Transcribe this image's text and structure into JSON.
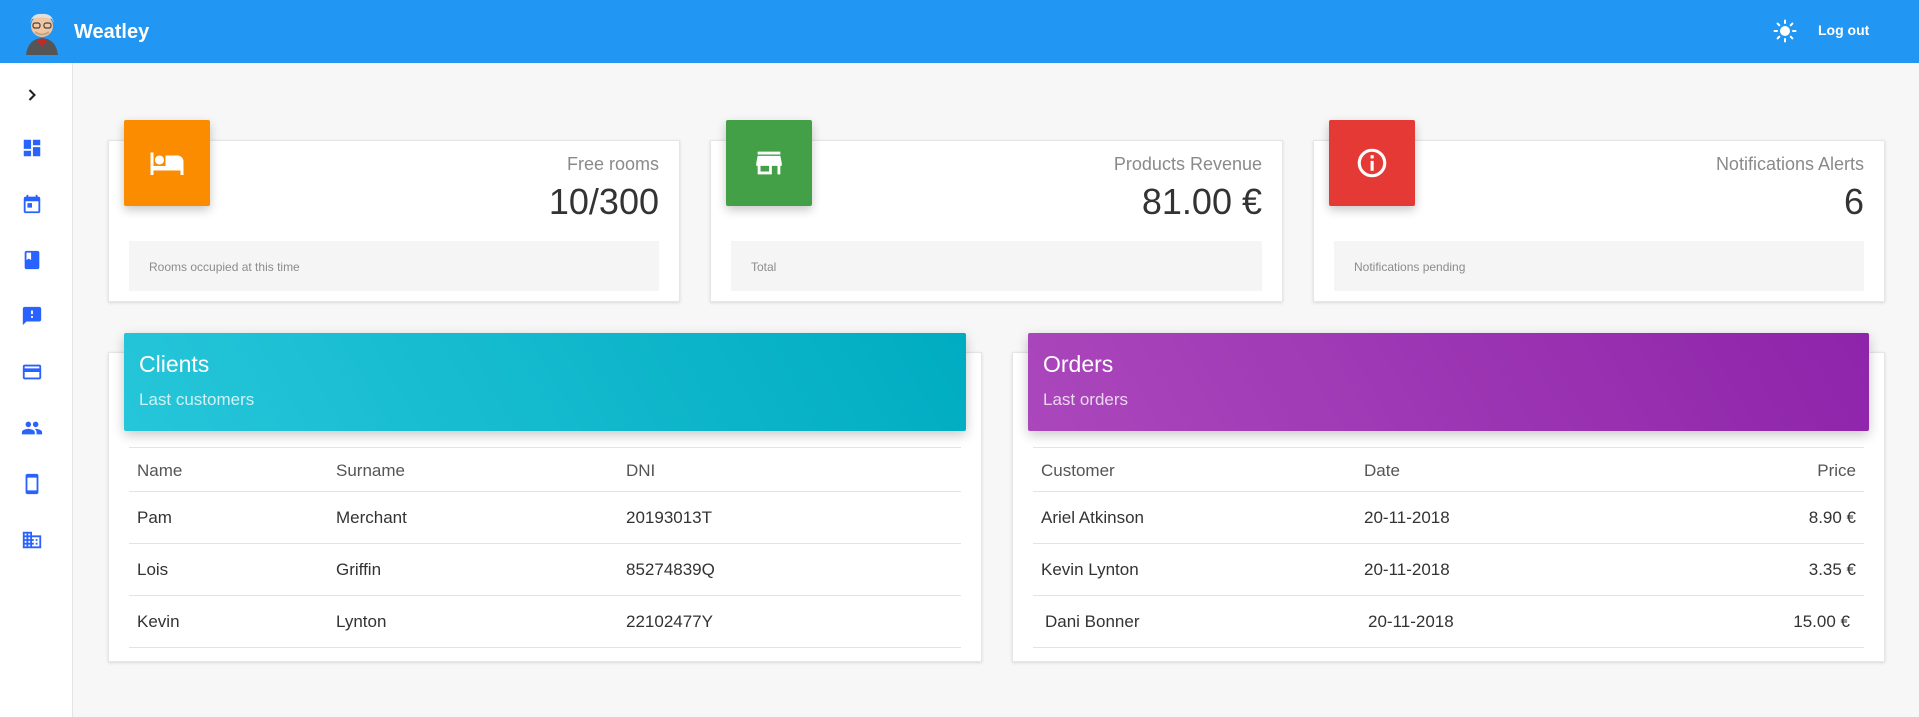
{
  "app": {
    "title": "Weatley"
  },
  "header": {
    "logout_label": "Log out",
    "theme_icon": "sun-icon"
  },
  "sidebar": {
    "items": [
      {
        "icon": "chevron-right-icon"
      },
      {
        "icon": "dashboard-icon"
      },
      {
        "icon": "calendar-icon"
      },
      {
        "icon": "book-icon"
      },
      {
        "icon": "feedback-icon"
      },
      {
        "icon": "credit-card-icon"
      },
      {
        "icon": "people-icon"
      },
      {
        "icon": "smartphone-icon"
      },
      {
        "icon": "business-icon"
      }
    ],
    "accent_color": "#2962ff"
  },
  "stats": [
    {
      "title": "Free rooms",
      "value": "10/300",
      "footer": "Rooms occupied at this time",
      "icon": "bed-icon",
      "color": "#fb8c00"
    },
    {
      "title": "Products Revenue",
      "value": "81.00 €",
      "footer": "Total",
      "icon": "store-icon",
      "color": "#43a047"
    },
    {
      "title": "Notifications Alerts",
      "value": "6",
      "footer": "Notifications pending",
      "icon": "info-icon",
      "color": "#e53935"
    }
  ],
  "clients": {
    "title": "Clients",
    "subtitle": "Last customers",
    "columns": [
      "Name",
      "Surname",
      "DNI"
    ],
    "rows": [
      [
        "Pam",
        "Merchant",
        "20193013T"
      ],
      [
        "Lois",
        "Griffin",
        "85274839Q"
      ],
      [
        "Kevin",
        "Lynton",
        "22102477Y"
      ]
    ],
    "colors": [
      "#26c6da",
      "#00acc1"
    ]
  },
  "orders": {
    "title": "Orders",
    "subtitle": "Last orders",
    "columns": [
      "Customer",
      "Date",
      "Price"
    ],
    "rows": [
      [
        "Ariel Atkinson",
        "20-11-2018",
        "8.90 €"
      ],
      [
        "Kevin Lynton",
        "20-11-2018",
        "3.35 €"
      ],
      [
        " Dani Bonner",
        " 20-11-2018",
        "15.00 € "
      ]
    ],
    "colors": [
      "#ab47bc",
      "#8e24aa"
    ]
  }
}
